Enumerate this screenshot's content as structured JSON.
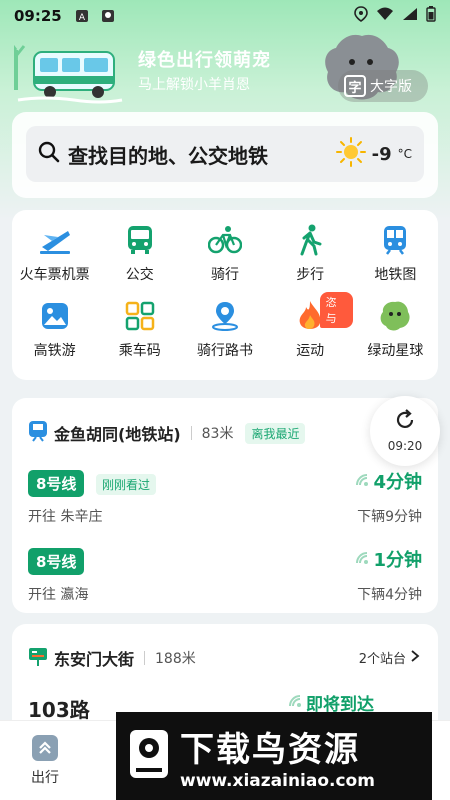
{
  "status_bar": {
    "time": "09:25"
  },
  "banner": {
    "title": "绿色出行领萌宠",
    "subtitle": "马上解锁小羊肖恩",
    "big_font_label": "大字版",
    "big_font_glyph": "字"
  },
  "search": {
    "placeholder": "查找目的地、公交地铁",
    "weather_temp": "-9",
    "weather_unit": "°C"
  },
  "shortcuts": [
    {
      "label": "火车票机票",
      "icon": "train-plane-icon"
    },
    {
      "label": "公交",
      "icon": "bus-icon"
    },
    {
      "label": "骑行",
      "icon": "bike-icon"
    },
    {
      "label": "步行",
      "icon": "walk-icon"
    },
    {
      "label": "地铁图",
      "icon": "subway-icon"
    },
    {
      "label": "高铁游",
      "icon": "photo-icon"
    },
    {
      "label": "乘车码",
      "icon": "qr-code-icon"
    },
    {
      "label": "骑行路书",
      "icon": "route-pin-icon"
    },
    {
      "label": "运动",
      "icon": "flame-icon",
      "badge": "恣与"
    },
    {
      "label": "绿动星球",
      "icon": "mascot-icon"
    }
  ],
  "station1": {
    "name": "金鱼胡同(地铁站)",
    "distance": "83米",
    "tag": "离我最近",
    "refresh_time": "09:20",
    "lines": [
      {
        "line": "8号线",
        "seen": "刚刚看过",
        "direction": "开往 朱辛庄",
        "arrival": "4分钟",
        "next": "下辆9分钟"
      },
      {
        "line": "8号线",
        "seen": "",
        "direction": "开往 瀛海",
        "arrival": "1分钟",
        "next": "下辆4分钟"
      }
    ]
  },
  "station2": {
    "name": "东安门大街",
    "distance": "188米",
    "stops": "2个站台",
    "route": "103路",
    "status": "即将到达"
  },
  "bottom_nav": {
    "label": "出行"
  },
  "watermark": {
    "text": "下载鸟资源",
    "url": "www.xiazainiao.com"
  },
  "colors": {
    "accent": "#11a06a",
    "badge": "#ff5a3c"
  }
}
